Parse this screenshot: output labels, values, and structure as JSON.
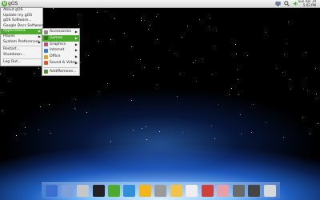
{
  "top_panel": {
    "menu_label": "gOS",
    "clock_day": "Sun Apr 19",
    "clock_time": "5:02 PM"
  },
  "main_menu": {
    "items": [
      {
        "label": "About gOS"
      },
      {
        "label": "Update my gOS"
      },
      {
        "label": "gOS Software..."
      },
      {
        "label": "Google Docs Software"
      },
      {
        "label": "Applications"
      },
      {
        "label": "Places"
      },
      {
        "label": "System Preferences"
      },
      {
        "label": "Restart..."
      },
      {
        "label": "Shutdown..."
      },
      {
        "label": "Log Out..."
      }
    ]
  },
  "applications_menu": {
    "items": [
      {
        "label": "Accessories",
        "color": "#8a8a8a"
      },
      {
        "label": "Games",
        "color": "#4caa2c"
      },
      {
        "label": "Graphics",
        "color": "#c0507a"
      },
      {
        "label": "Internet",
        "color": "#3a7bd5"
      },
      {
        "label": "Office",
        "color": "#d8a530"
      },
      {
        "label": "Sound & Video",
        "color": "#e05a2a"
      },
      {
        "label": "Add/Remove...",
        "color": "#5c8a3c"
      }
    ]
  },
  "dock_items": [
    {
      "name": "word-processor-icon",
      "color": "#3a6fd0"
    },
    {
      "name": "mail-icon",
      "color": "#7da0d8"
    },
    {
      "name": "files-icon",
      "color": "#c7c7c7"
    },
    {
      "name": "media-player-icon",
      "color": "#222222"
    },
    {
      "name": "chat-icon",
      "color": "#4caa2c"
    },
    {
      "name": "news-icon",
      "color": "#2f8fd8"
    },
    {
      "name": "favorites-star-icon",
      "color": "#f2b51c"
    },
    {
      "name": "search-icon",
      "color": "#9a9a9a"
    },
    {
      "name": "people-icon",
      "color": "#f2c24a"
    },
    {
      "name": "clock-icon",
      "color": "#eeeeee"
    },
    {
      "name": "paint-icon",
      "color": "#d0403a"
    },
    {
      "name": "calendar-icon",
      "color": "#e8a0a8"
    },
    {
      "name": "settings-icon",
      "color": "#6a6a6a"
    },
    {
      "name": "terminal-icon",
      "color": "#444444"
    },
    {
      "name": "trash-icon",
      "color": "#d8d8d8"
    }
  ]
}
